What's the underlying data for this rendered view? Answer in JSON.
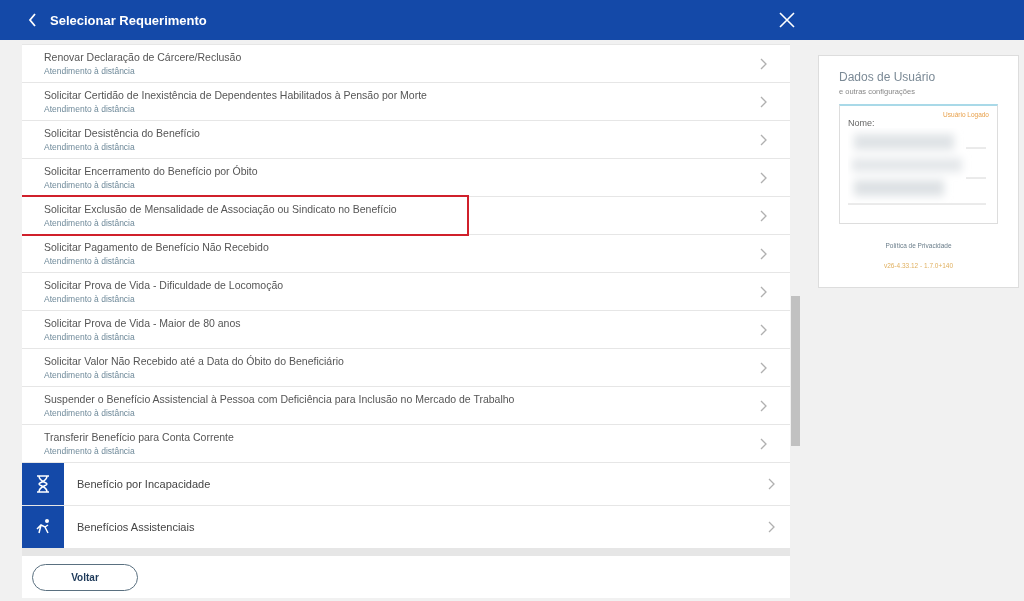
{
  "header": {
    "title": "Selecionar Requerimento"
  },
  "items": [
    {
      "title": "Renovar Declaração de Cárcere/Reclusão",
      "subtitle": "Atendimento à distância",
      "highlighted": false
    },
    {
      "title": "Solicitar Certidão de Inexistência de Dependentes Habilitados à Pensão por Morte",
      "subtitle": "Atendimento à distância",
      "highlighted": false
    },
    {
      "title": "Solicitar Desistência do Benefício",
      "subtitle": "Atendimento à distância",
      "highlighted": false
    },
    {
      "title": "Solicitar Encerramento do Benefício por Óbito",
      "subtitle": "Atendimento à distância",
      "highlighted": false
    },
    {
      "title": "Solicitar Exclusão de Mensalidade de Associação ou Sindicato no Benefício",
      "subtitle": "Atendimento à distância",
      "highlighted": true
    },
    {
      "title": "Solicitar Pagamento de Benefício Não Recebido",
      "subtitle": "Atendimento à distância",
      "highlighted": false
    },
    {
      "title": "Solicitar Prova de Vida - Dificuldade de Locomoção",
      "subtitle": "Atendimento à distância",
      "highlighted": false
    },
    {
      "title": "Solicitar Prova de Vida - Maior de 80 anos",
      "subtitle": "Atendimento à distância",
      "highlighted": false
    },
    {
      "title": "Solicitar Valor Não Recebido até a Data do Óbito do Beneficiário",
      "subtitle": "Atendimento à distância",
      "highlighted": false
    },
    {
      "title": "Suspender o Benefício Assistencial à Pessoa com Deficiência para Inclusão no Mercado de Trabalho",
      "subtitle": "Atendimento à distância",
      "highlighted": false
    },
    {
      "title": "Transferir Benefício para Conta Corrente",
      "subtitle": "Atendimento à distância",
      "highlighted": false
    }
  ],
  "categories": [
    {
      "label": "Benefício por Incapacidade",
      "kind": "hourglass"
    },
    {
      "label": "Benefícios Assistenciais",
      "kind": "person"
    }
  ],
  "footer": {
    "button": "Voltar"
  },
  "user_card": {
    "title": "Dados de Usuário",
    "subtitle": "e outras configurações",
    "status": "Usuário Logado",
    "name_label": "Nome:",
    "privacy_link": "Política de Privacidade",
    "version": "v26-4.33.12 - 1.7.0+140"
  }
}
